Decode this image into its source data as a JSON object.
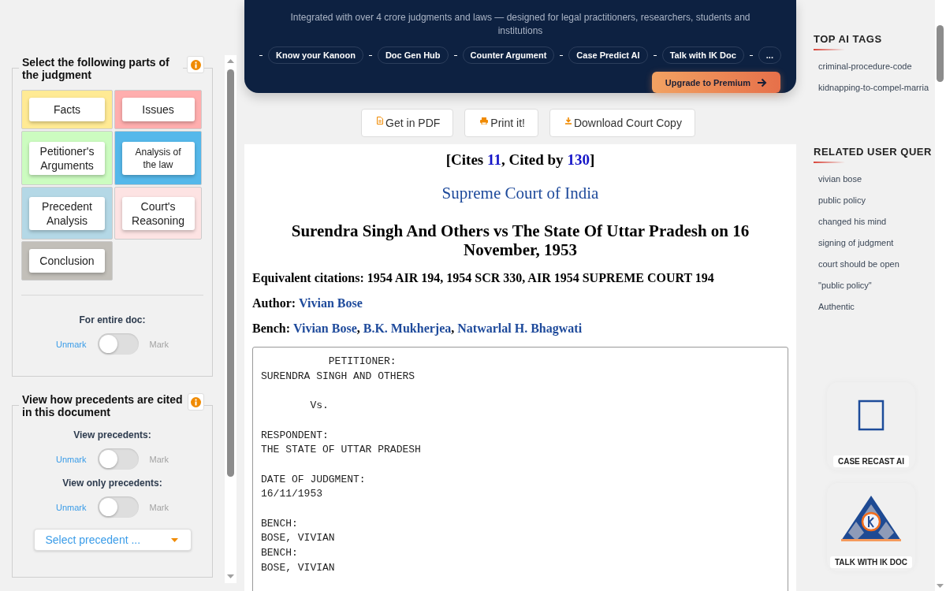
{
  "left_panel": {
    "parts_box": {
      "title": "Select the following parts of the judgment",
      "parts": [
        {
          "label": "Facts",
          "color": "#ffea94",
          "small": false
        },
        {
          "label": "Issues",
          "color": "#ffaeae",
          "small": false
        },
        {
          "label": "Petitioner's Arguments",
          "color": "#ccfcc0",
          "small": false
        },
        {
          "label": "Analysis of the law",
          "color": "#55b8ea",
          "small": true
        },
        {
          "label": "Precedent Analysis",
          "color": "#b4d8e6",
          "small": false
        },
        {
          "label": "Court's Reasoning",
          "color": "#fde3e3",
          "small": false
        },
        {
          "label": "Conclusion",
          "color": "#c2bfb9",
          "small": false
        }
      ],
      "toggles": [
        {
          "label": "For entire doc:",
          "off_label": "Unmark",
          "on_label": "Mark",
          "on": false
        }
      ]
    },
    "precedents_box": {
      "title": "View how precedents are cited in this document",
      "toggles": [
        {
          "label": "View precedents:",
          "off_label": "Unmark",
          "on_label": "Mark",
          "on": false
        },
        {
          "label": "View only precedents:",
          "off_label": "Unmark",
          "on_label": "Mark",
          "on": false
        }
      ],
      "select": {
        "placeholder": "Select precedent ..."
      }
    }
  },
  "banner": {
    "subtitle": "Integrated with over 4 crore judgments and laws — designed for legal practitioners, researchers, students and institutions",
    "chips": [
      "Know your Kanoon",
      "Doc Gen Hub",
      "Counter Argument",
      "Case Predict AI",
      "Talk with IK Doc",
      "..."
    ],
    "upgrade_button": "Upgrade to Premium"
  },
  "actions": [
    {
      "label": "Get in PDF",
      "kind": "pdf"
    },
    {
      "label": "Print it!",
      "kind": "print"
    },
    {
      "label": "Download Court Copy",
      "kind": "download"
    }
  ],
  "document": {
    "cites": {
      "open": "[Cites ",
      "cites_count": "11",
      "middle": ", Cited by ",
      "cited_by_count": "130",
      "close": "]"
    },
    "court": "Supreme Court of India",
    "title": "Surendra Singh And Others vs The State Of Uttar Pradesh on 16 November, 1953",
    "citations": "Equivalent citations: 1954 AIR 194, 1954 SCR 330, AIR 1954 SUPREME COURT 194",
    "author": {
      "label": "Author:",
      "name": "Vivian Bose"
    },
    "bench": {
      "label": "Bench:",
      "separator": ",",
      "judges": [
        "Vivian Bose",
        "B.K. Mukherjea",
        "Natwarlal H. Bhagwati"
      ]
    },
    "text": "           PETITIONER:\nSURENDRA SINGH AND OTHERS\n\n        Vs.\n\nRESPONDENT:\nTHE STATE OF UTTAR PRADESH\n\nDATE OF JUDGMENT:\n16/11/1953\n\nBENCH:\nBOSE, VIVIAN\nBENCH:\nBOSE, VIVIAN"
  },
  "right_panel": {
    "sections": [
      {
        "title": "TOP AI TAGS",
        "items": [
          "criminal-procedure-code",
          "kidnapping-to-compel-marria"
        ]
      },
      {
        "title": "RELATED USER QUER",
        "items": [
          "vivian bose",
          "public policy",
          "changed his mind",
          "signing of judgment",
          "court should be open",
          "\"public policy\"",
          "Authentic"
        ]
      }
    ],
    "tools": [
      {
        "label": "CASE RECAST AI",
        "kind": "recast"
      },
      {
        "label": "TALK WITH IK DOC",
        "kind": "ikdoc"
      }
    ]
  }
}
